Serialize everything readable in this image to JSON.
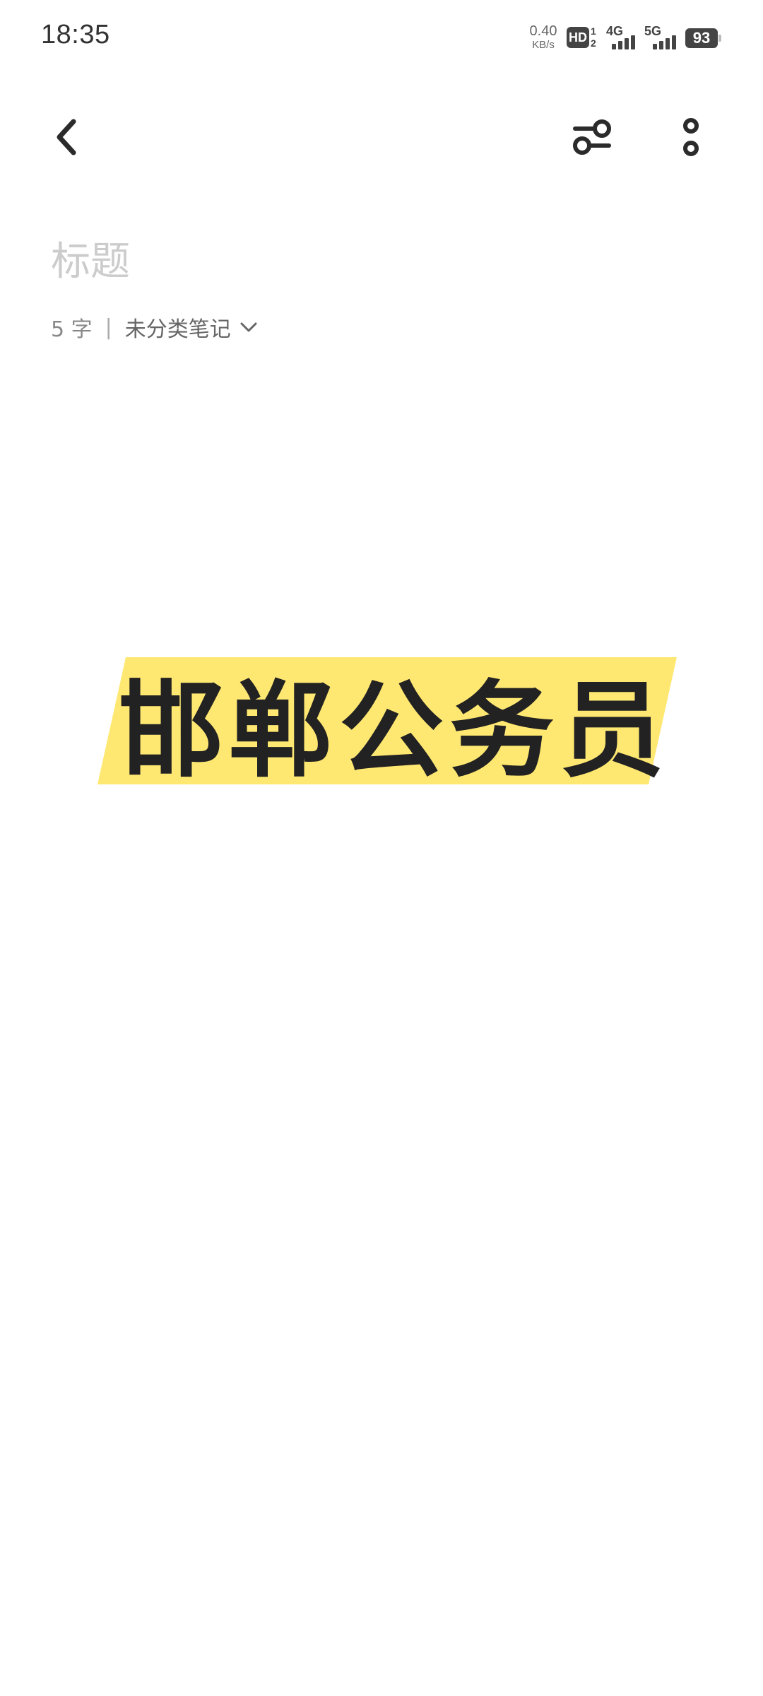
{
  "status_bar": {
    "time": "18:35",
    "net_speed_value": "0.40",
    "net_speed_unit": "KB/s",
    "hd_label": "HD",
    "hd_sub_top": "1",
    "hd_sub_bottom": "2",
    "signal_1_label": "4G",
    "signal_2_label": "5G",
    "battery_level": "93"
  },
  "toolbar": {
    "back_icon": "chevron-left-icon",
    "format_icon": "sliders-icon",
    "more_icon": "more-vertical-icon"
  },
  "note": {
    "title_value": "",
    "title_placeholder": "标题",
    "word_count": "5 字",
    "separator": "|",
    "category": "未分类笔记",
    "category_icon": "chevron-down-icon",
    "cover_text": "邯郸公务员",
    "highlight_color": "#FFE872"
  }
}
